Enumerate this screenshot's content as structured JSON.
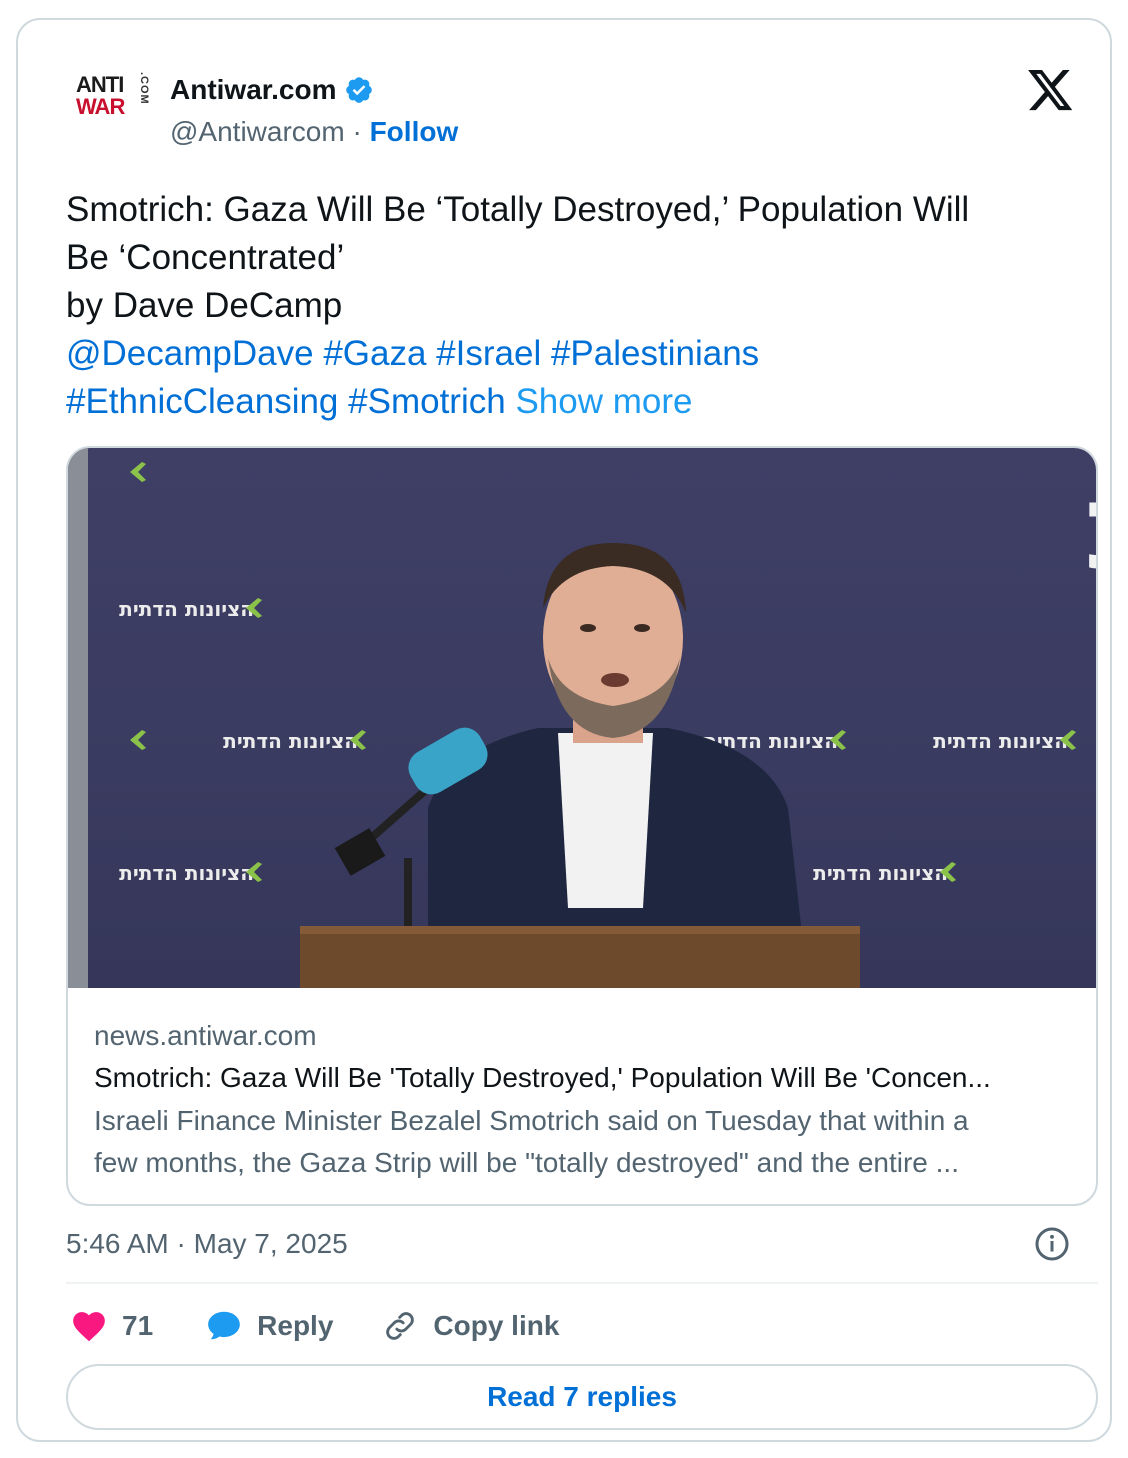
{
  "author": {
    "avatar_line1": "ANTI",
    "avatar_line2": "WAR",
    "avatar_com": ".COM",
    "name": "Antiwar.com",
    "handle": "@Antiwarcom",
    "separator": "·",
    "follow_label": "Follow",
    "verified_icon": "verified-badge-icon",
    "platform_icon": "x-logo-icon"
  },
  "tweet": {
    "line1": "Smotrich: Gaza Will Be ‘Totally Destroyed,’ Population Will",
    "line2": "Be ‘Concentrated’",
    "line3": "by Dave DeCamp",
    "mention": "@DecampDave",
    "tags_line1": [
      "#Gaza",
      "#Israel",
      "#Palestinians"
    ],
    "tags_line2": [
      "#EthnicCleansing",
      "#Smotrich"
    ],
    "show_more": "Show more"
  },
  "link_card": {
    "media_text_large": "הציונות הדתית",
    "media_text_small": "הציונות הדתית",
    "domain": "news.antiwar.com",
    "title": "Smotrich: Gaza Will Be 'Totally Destroyed,' Population Will Be 'Concen...",
    "desc_line1": "Israeli Finance Minister Bezalel Smotrich said on Tuesday that within a",
    "desc_line2": "few months, the Gaza Strip will be \"totally destroyed\" and the entire ..."
  },
  "footer": {
    "timestamp": "5:46 AM · May 7, 2025",
    "like_count": "71",
    "reply_label": "Reply",
    "copy_label": "Copy link",
    "read_replies": "Read 7 replies",
    "colors": {
      "like": "#f91880",
      "reply": "#1d9bf0",
      "link": "#006fd6",
      "muted": "#536471"
    }
  }
}
